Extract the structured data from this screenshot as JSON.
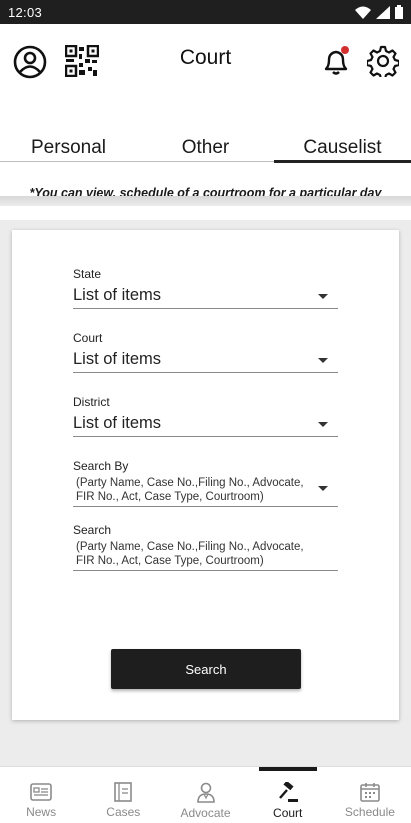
{
  "status_bar": {
    "time": "12:03"
  },
  "header": {
    "title": "Court"
  },
  "tabs": [
    {
      "label": "Personal",
      "active": false
    },
    {
      "label": "Other",
      "active": false
    },
    {
      "label": "Causelist",
      "active": true
    }
  ],
  "notice": "*You can view,  schedule of a courtroom for a particular day",
  "form": {
    "state": {
      "label": "State",
      "value": "List of items"
    },
    "court": {
      "label": "Court",
      "value": "List of items"
    },
    "district": {
      "label": "District",
      "value": "List of items"
    },
    "search_by": {
      "label": "Search By",
      "hint": "(Party Name, Case No.,Filing No., Advocate, FIR No., Act, Case Type, Courtroom)"
    },
    "search": {
      "label": "Search",
      "hint": "(Party Name, Case No.,Filing No., Advocate, FIR No., Act, Case Type, Courtroom)"
    },
    "submit_label": "Search"
  },
  "bottom_nav": [
    {
      "label": "News",
      "icon": "news-icon",
      "active": false
    },
    {
      "label": "Cases",
      "icon": "cases-icon",
      "active": false
    },
    {
      "label": "Advocate",
      "icon": "advocate-icon",
      "active": false
    },
    {
      "label": "Court",
      "icon": "gavel-icon",
      "active": true
    },
    {
      "label": "Schedule",
      "icon": "calendar-icon",
      "active": false
    }
  ],
  "colors": {
    "accent": "#1e1e1e",
    "notification_dot": "#d32f2f",
    "status_bar": "#1f1f1f"
  }
}
